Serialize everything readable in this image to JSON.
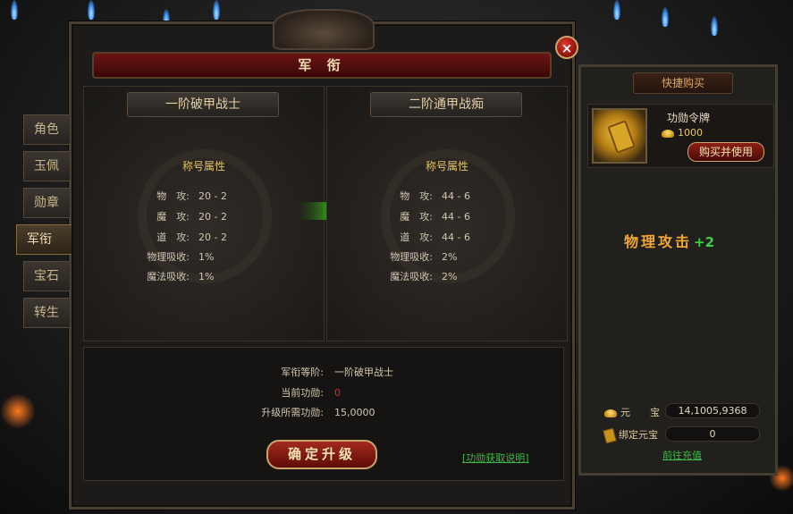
{
  "window": {
    "title": "军 衔",
    "close_label": "×"
  },
  "tabs": [
    {
      "label": "角色"
    },
    {
      "label": "玉佩"
    },
    {
      "label": "勋章"
    },
    {
      "label": "军衔"
    },
    {
      "label": "宝石"
    },
    {
      "label": "转生"
    }
  ],
  "active_tab": "军衔",
  "current_rank": {
    "name": "一阶破甲战士",
    "attr_title": "称号属性",
    "attrs": [
      {
        "label": "物　攻:",
        "value": "20 - 2"
      },
      {
        "label": "魔　攻:",
        "value": "20 - 2"
      },
      {
        "label": "道　攻:",
        "value": "20 - 2"
      },
      {
        "label": "物理吸收:",
        "value": "1%"
      },
      {
        "label": "魔法吸收:",
        "value": "1%"
      }
    ]
  },
  "next_rank": {
    "name": "二阶通甲战痴",
    "attr_title": "称号属性",
    "attrs": [
      {
        "label": "物　攻:",
        "value": "44 - 6"
      },
      {
        "label": "魔　攻:",
        "value": "44 - 6"
      },
      {
        "label": "道　攻:",
        "value": "44 - 6"
      },
      {
        "label": "物理吸收:",
        "value": "2%"
      },
      {
        "label": "魔法吸收:",
        "value": "2%"
      }
    ]
  },
  "info": {
    "rank_label": "军衔等阶:",
    "rank_value": "一阶破甲战士",
    "merit_label": "当前功勋:",
    "merit_value": "0",
    "required_label": "升级所需功勋:",
    "required_value": "15,0000",
    "upgrade_button": "确定升级",
    "help_link": "[功勋获取说明]"
  },
  "shop": {
    "title": "快捷购买",
    "item_name": "功勋令牌",
    "item_price": "1000",
    "buy_button": "购买并使用",
    "bonus_text": "物理攻击",
    "bonus_value": "+2",
    "yuanbao_label": "元　　宝",
    "yuanbao_value": "14,1005,9368",
    "bound_label": "绑定元宝",
    "bound_value": "0",
    "recharge_link": "前往充值"
  },
  "colors": {
    "title_red": "#6b1414",
    "gold_text": "#e6c56a",
    "link_green": "#41b84b",
    "merit_red": "#e22a1a"
  },
  "icons": [
    "close-icon",
    "medal-token-icon",
    "gold-ingot-icon",
    "scroll-icon",
    "arrow-right-icon"
  ]
}
